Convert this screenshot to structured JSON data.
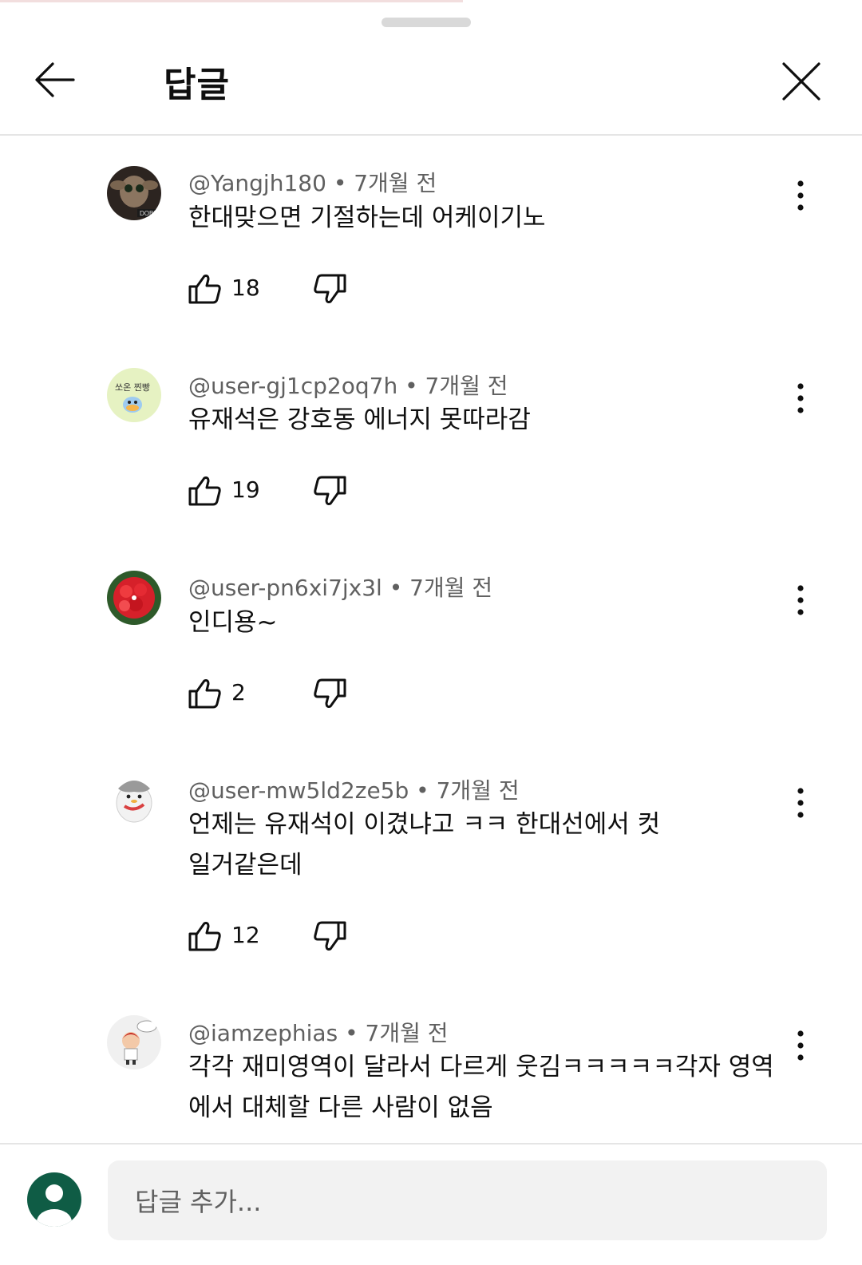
{
  "header": {
    "title": "답글"
  },
  "comments": [
    {
      "author": "@Yangjh180",
      "time": "7개월 전",
      "text": "한대맞으면 기절하는데 어케이기노",
      "likes": "18",
      "avatar_color": "#3b2f2a"
    },
    {
      "author": "@user-gj1cp2oq7h",
      "time": "7개월 전",
      "text": "유재석은 강호동 에너지 못따라감",
      "likes": "19",
      "avatar_color": "#e6f2c2"
    },
    {
      "author": "@user-pn6xi7jx3l",
      "time": "7개월 전",
      "text": "인디용~",
      "likes": "2",
      "avatar_color": "#d6202a"
    },
    {
      "author": "@user-mw5ld2ze5b",
      "time": "7개월 전",
      "text": "언제는 유재석이 이겼냐고 ㅋㅋ 한대선에서 컷일거같은데",
      "likes": "12",
      "avatar_color": "#f5f5f5"
    },
    {
      "author": "@iamzephias",
      "time": "7개월 전",
      "text": "각각 재미영역이 달라서 다르게 웃김ㅋㅋㅋㅋㅋ각자 영역에서 대체할 다른 사람이 없음",
      "likes": "",
      "avatar_color": "#f0f0f0"
    }
  ],
  "footer": {
    "placeholder": "답글 추가..."
  },
  "separator": "•"
}
